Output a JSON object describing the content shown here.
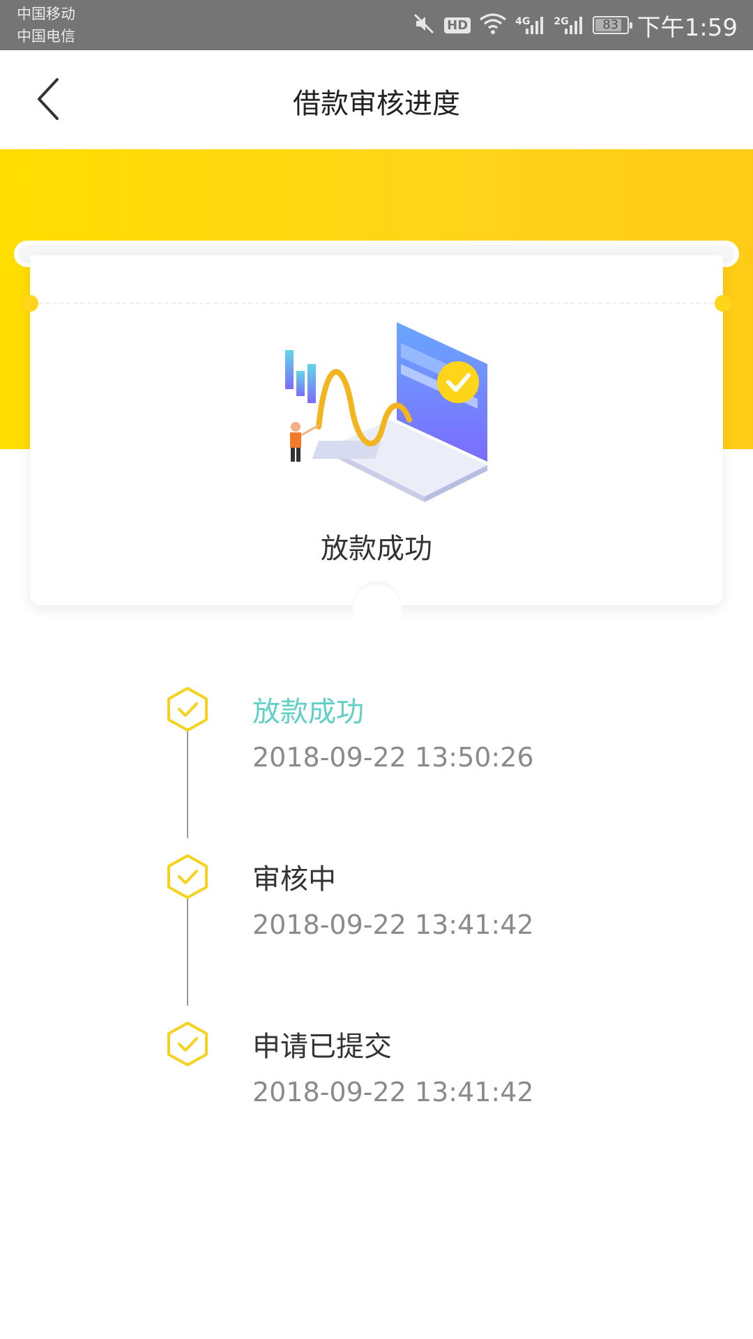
{
  "status_bar": {
    "carrier_1": "中国移动",
    "carrier_2": "中国电信",
    "hd": "HD",
    "net_1": "4G",
    "net_2": "2G",
    "battery": "83",
    "time": "下午1:59"
  },
  "nav": {
    "title": "借款审核进度"
  },
  "card": {
    "status": "放款成功"
  },
  "timeline": [
    {
      "label": "放款成功",
      "time": "2018-09-22 13:50:26"
    },
    {
      "label": "审核中",
      "time": "2018-09-22 13:41:42"
    },
    {
      "label": "申请已提交",
      "time": "2018-09-22 13:41:42"
    }
  ],
  "colors": {
    "accent_yellow": "#ffd51a",
    "active_teal": "#5fd0c8",
    "muted_text": "#8a8a8a"
  },
  "progress": {
    "battery_percent": 83
  }
}
